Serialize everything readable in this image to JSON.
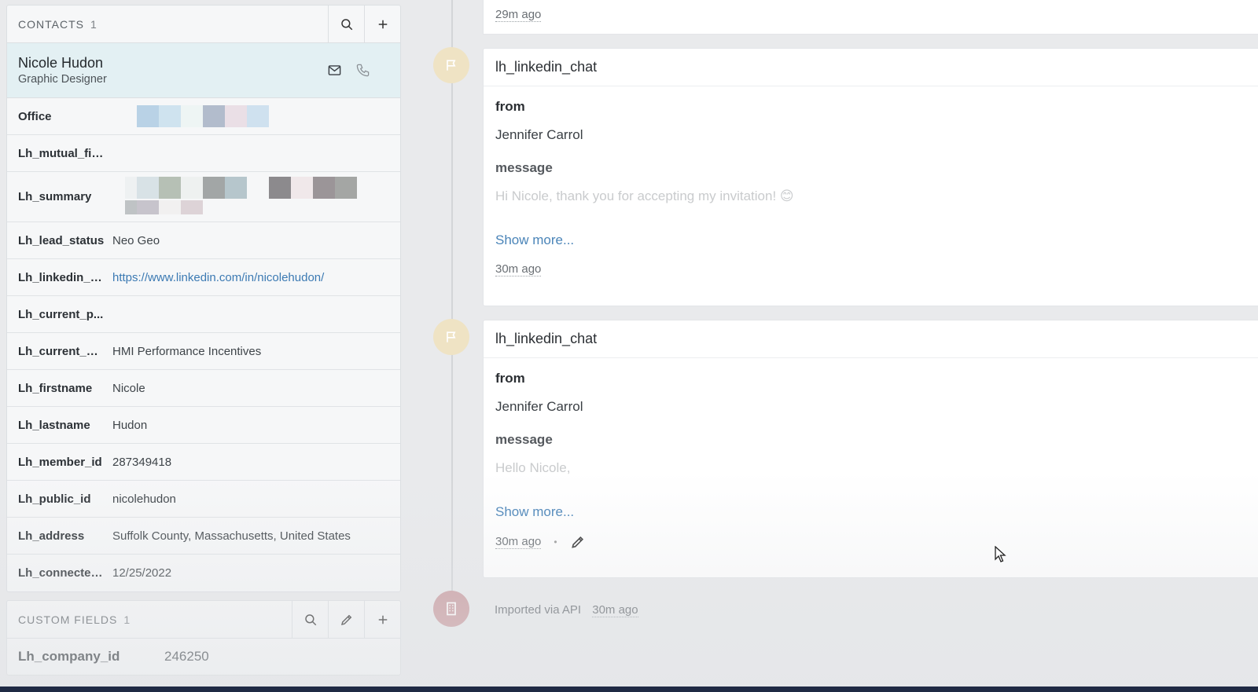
{
  "contacts": {
    "title": "CONTACTS",
    "count": "1",
    "contact": {
      "name": "Nicole Hudon",
      "role": "Graphic Designer"
    },
    "fields": [
      {
        "key": "Office",
        "value": ""
      },
      {
        "key": "Lh_mutual_first",
        "value": ""
      },
      {
        "key": "Lh_summary",
        "value": ""
      },
      {
        "key": "Lh_lead_status",
        "value": "Neo Geo"
      },
      {
        "key": "Lh_linkedin_p...",
        "value": "https://www.linkedin.com/in/nicolehudon/"
      },
      {
        "key": "Lh_current_p...",
        "value": ""
      },
      {
        "key": "Lh_current_co...",
        "value": "HMI Performance Incentives"
      },
      {
        "key": "Lh_firstname",
        "value": "Nicole"
      },
      {
        "key": "Lh_lastname",
        "value": "Hudon"
      },
      {
        "key": "Lh_member_id",
        "value": "287349418"
      },
      {
        "key": "Lh_public_id",
        "value": "nicolehudon"
      },
      {
        "key": "Lh_address",
        "value": "Suffolk County, Massachusetts, United States"
      },
      {
        "key": "Lh_connected...",
        "value": "12/25/2022"
      }
    ]
  },
  "custom_fields": {
    "title": "CUSTOM FIELDS",
    "count": "1",
    "fields": [
      {
        "key": "Lh_company_id",
        "value": "246250"
      }
    ]
  },
  "timeline": {
    "top_ago": "29m ago",
    "items": [
      {
        "title": "lh_linkedin_chat",
        "from_label": "from",
        "from_value": "Jennifer Carrol",
        "message_label": "message",
        "message_preview": "Hi Nicole, thank you for accepting my invitation! 😊",
        "show_more": "Show more...",
        "ago": "30m ago"
      },
      {
        "title": "lh_linkedin_chat",
        "from_label": "from",
        "from_value": "Jennifer Carrol",
        "message_label": "message",
        "message_preview": "Hello Nicole,",
        "show_more": "Show more...",
        "ago": "30m ago"
      }
    ],
    "api": {
      "text": "Imported via API",
      "ago": "30m ago"
    }
  },
  "icons": [
    "search-icon",
    "plus-icon",
    "mail-icon",
    "phone-icon",
    "flag-icon",
    "pencil-icon",
    "building-icon"
  ]
}
